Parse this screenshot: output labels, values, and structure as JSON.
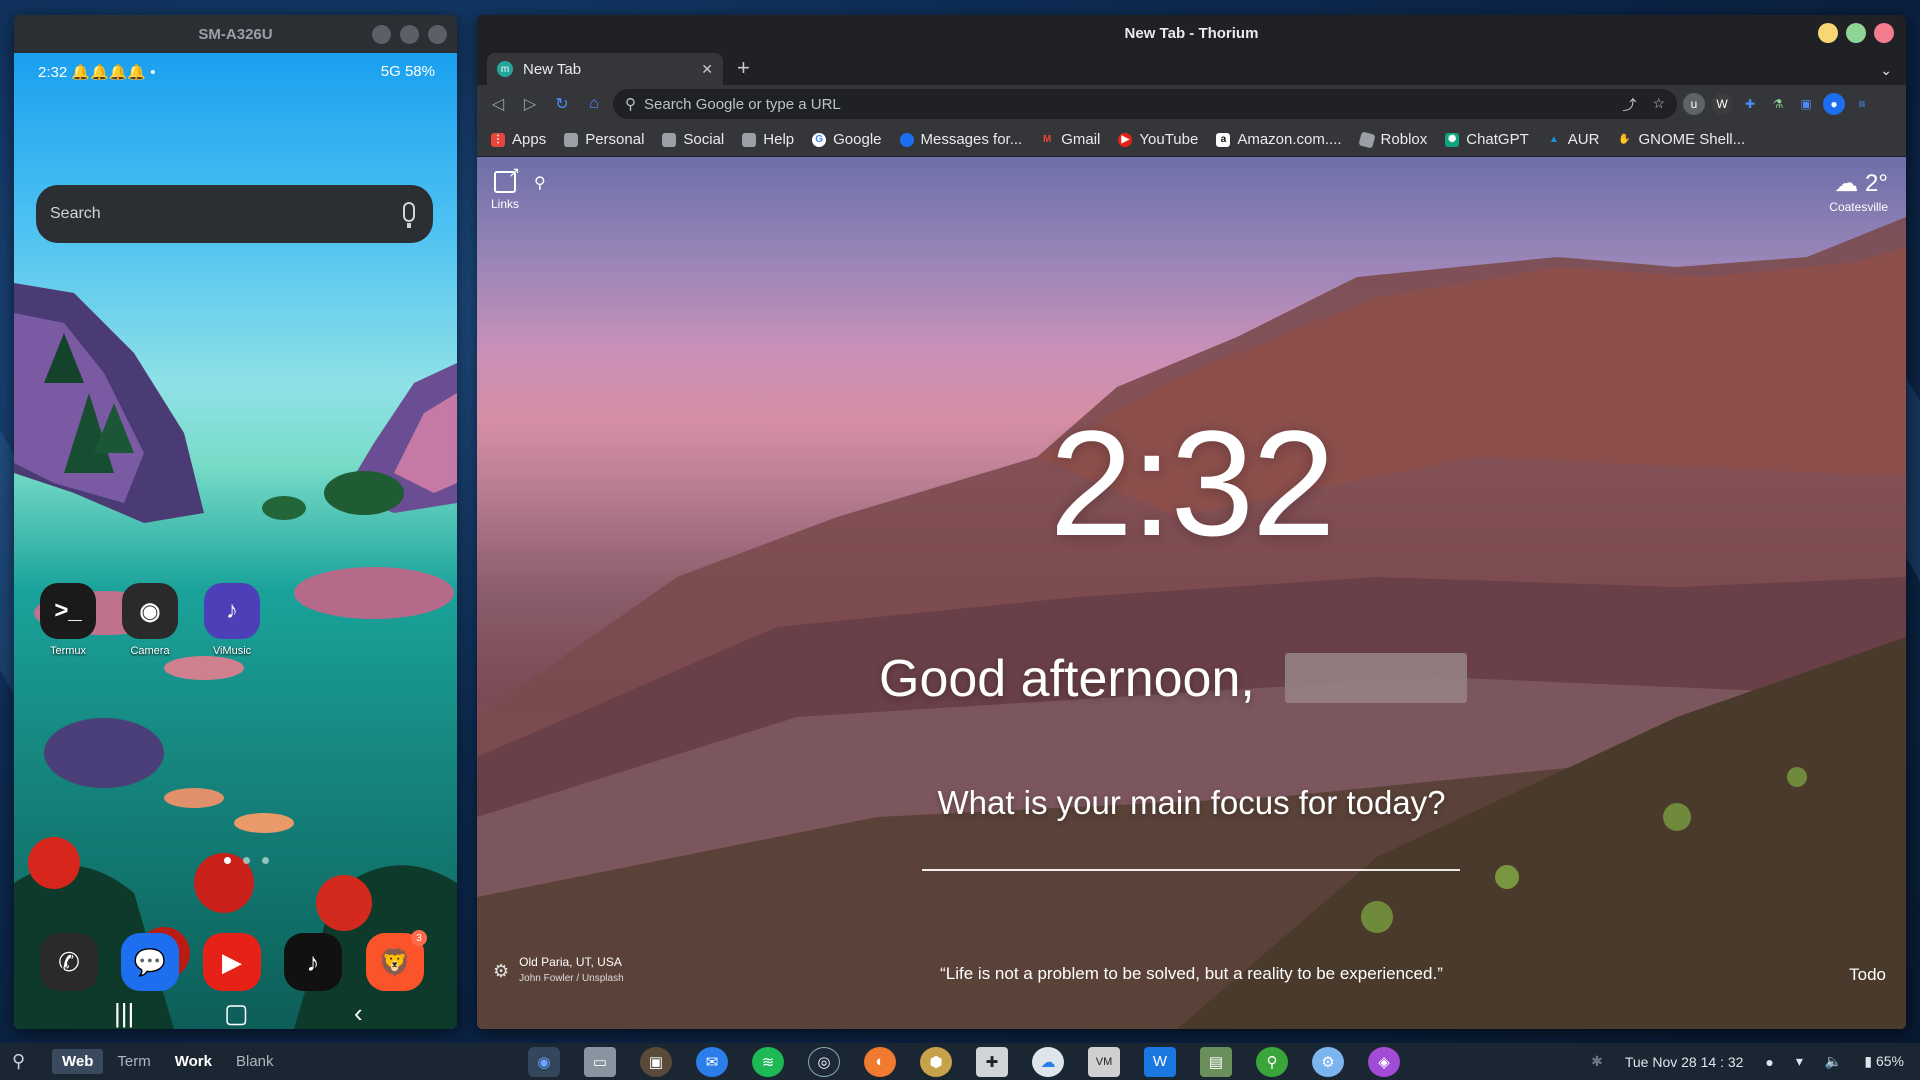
{
  "phone": {
    "window_title": "SM-A326U",
    "status_time": "2:32",
    "status_icons": "5G",
    "battery": "58%",
    "search_placeholder": "Search",
    "apps": [
      {
        "label": "Termux",
        "icon": "terminal-icon",
        "color": "#1a1a1a",
        "glyph": ">_"
      },
      {
        "label": "Camera",
        "icon": "camera-icon",
        "color": "#2a2a2a",
        "glyph": "◉"
      },
      {
        "label": "ViMusic",
        "icon": "music-icon",
        "color": "#4c3fb8",
        "glyph": "♪"
      }
    ],
    "dock": [
      {
        "icon": "phone-icon",
        "color": "#2a2a2a",
        "glyph": "✆"
      },
      {
        "icon": "messages-icon",
        "color": "#1e6ff0",
        "glyph": "💬"
      },
      {
        "icon": "youtube-icon",
        "color": "#e62117",
        "glyph": "▶"
      },
      {
        "icon": "tiktok-icon",
        "color": "#111111",
        "glyph": "♪"
      },
      {
        "icon": "brave-icon",
        "color": "#fb542b",
        "glyph": "🦁",
        "badge": "3"
      }
    ]
  },
  "browser": {
    "window_title": "New Tab - Thorium",
    "tab_title": "New Tab",
    "omnibox_placeholder": "Search Google or type a URL",
    "bookmarks": [
      {
        "label": "Apps",
        "icon": "apps-grid-icon",
        "color": "#e8453c"
      },
      {
        "label": "Personal",
        "icon": "folder-icon",
        "color": "#c7c9cc"
      },
      {
        "label": "Social",
        "icon": "folder-icon",
        "color": "#c7c9cc"
      },
      {
        "label": "Help",
        "icon": "folder-icon",
        "color": "#c7c9cc"
      },
      {
        "label": "Google",
        "icon": "google-icon",
        "color": "#4285f4"
      },
      {
        "label": "Messages for...",
        "icon": "messages-icon",
        "color": "#1e6ff0"
      },
      {
        "label": "Gmail",
        "icon": "gmail-icon",
        "color": "#ea4335"
      },
      {
        "label": "YouTube",
        "icon": "youtube-icon",
        "color": "#e62117"
      },
      {
        "label": "Amazon.com....",
        "icon": "amazon-icon",
        "color": "#ffffff"
      },
      {
        "label": "Roblox",
        "icon": "roblox-icon",
        "color": "#9aa0a6"
      },
      {
        "label": "ChatGPT",
        "icon": "chatgpt-icon",
        "color": "#10a37f"
      },
      {
        "label": "AUR",
        "icon": "arch-icon",
        "color": "#1793d1"
      },
      {
        "label": "GNOME Shell...",
        "icon": "gnome-icon",
        "color": "#9aa0a6"
      }
    ]
  },
  "momentum": {
    "links_label": "Links",
    "weather_temp": "2°",
    "weather_location": "Coatesville",
    "clock": "2:32",
    "greeting": "Good afternoon,",
    "focus_question": "What is your main focus for today?",
    "photo_location": "Old Paria, UT, USA",
    "photo_credit": "John Fowler / Unsplash",
    "quote": "“Life is not a problem to be solved, but a reality to be experienced.”",
    "todo_label": "Todo"
  },
  "taskbar": {
    "workspaces": [
      "Web",
      "Term",
      "Work",
      "Blank"
    ],
    "active_workspace": "Web",
    "datetime": "Tue Nov 28  14 : 32",
    "battery": "65%"
  }
}
